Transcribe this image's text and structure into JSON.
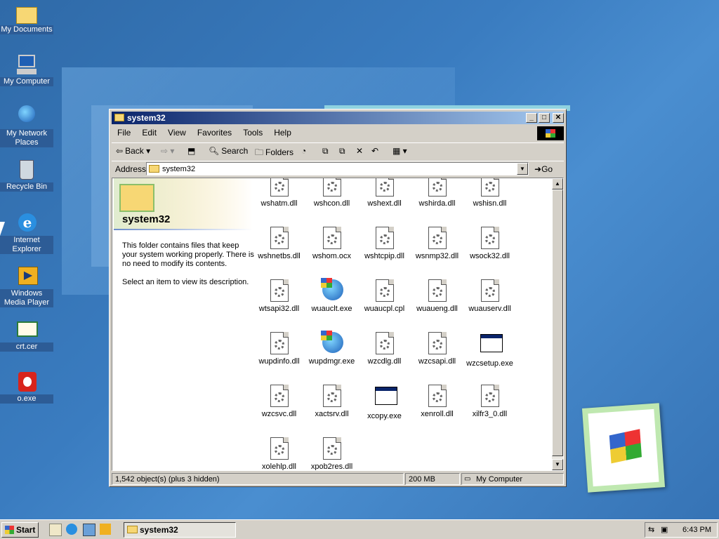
{
  "desktop": {
    "icons": [
      {
        "label": "My Documents",
        "icon": "folder-icon"
      },
      {
        "label": "My Computer",
        "icon": "computer-icon"
      },
      {
        "label": "My Network Places",
        "icon": "network-icon"
      },
      {
        "label": "Recycle Bin",
        "icon": "recycle-bin-icon"
      },
      {
        "label": "Internet Explorer",
        "icon": "internet-explorer-icon"
      },
      {
        "label": "Windows Media Player",
        "icon": "media-player-icon"
      },
      {
        "label": "crt.cer",
        "icon": "certificate-icon"
      },
      {
        "label": "o.exe",
        "icon": "app-icon"
      }
    ]
  },
  "window": {
    "title": "system32",
    "menu": [
      "File",
      "Edit",
      "View",
      "Favorites",
      "Tools",
      "Help"
    ],
    "toolbar": {
      "back": "Back",
      "search": "Search",
      "folders": "Folders"
    },
    "address": {
      "label": "Address",
      "value": "system32",
      "go": "Go"
    },
    "left_pane": {
      "title": "system32",
      "description": "This folder contains files that keep your system working properly. There is no need to modify its contents.",
      "hint": "Select an item to view its description."
    },
    "files": [
      {
        "name": "wshatm.dll",
        "type": "dll"
      },
      {
        "name": "wshcon.dll",
        "type": "dll"
      },
      {
        "name": "wshext.dll",
        "type": "dll"
      },
      {
        "name": "wshirda.dll",
        "type": "dll"
      },
      {
        "name": "wshisn.dll",
        "type": "dll"
      },
      {
        "name": "wshnetbs.dll",
        "type": "dll"
      },
      {
        "name": "wshom.ocx",
        "type": "dll"
      },
      {
        "name": "wshtcpip.dll",
        "type": "dll"
      },
      {
        "name": "wsnmp32.dll",
        "type": "dll"
      },
      {
        "name": "wsock32.dll",
        "type": "dll"
      },
      {
        "name": "wtsapi32.dll",
        "type": "dll"
      },
      {
        "name": "wuauclt.exe",
        "type": "globe"
      },
      {
        "name": "wuaucpl.cpl",
        "type": "dll"
      },
      {
        "name": "wuaueng.dll",
        "type": "dll"
      },
      {
        "name": "wuauserv.dll",
        "type": "dll"
      },
      {
        "name": "wupdinfo.dll",
        "type": "dll"
      },
      {
        "name": "wupdmgr.exe",
        "type": "globe"
      },
      {
        "name": "wzcdlg.dll",
        "type": "dll"
      },
      {
        "name": "wzcsapi.dll",
        "type": "dll"
      },
      {
        "name": "wzcsetup.exe",
        "type": "exe"
      },
      {
        "name": "wzcsvc.dll",
        "type": "dll"
      },
      {
        "name": "xactsrv.dll",
        "type": "dll"
      },
      {
        "name": "xcopy.exe",
        "type": "exe"
      },
      {
        "name": "xenroll.dll",
        "type": "dll"
      },
      {
        "name": "xilfr3_0.dll",
        "type": "dll"
      },
      {
        "name": "xolehlp.dll",
        "type": "dll"
      },
      {
        "name": "xpob2res.dll",
        "type": "dll"
      }
    ],
    "status": {
      "objects": "1,542 object(s) (plus 3 hidden)",
      "size": "200 MB",
      "zone": "My Computer"
    }
  },
  "taskbar": {
    "start": "Start",
    "task": "system32",
    "clock": "6:43 PM"
  }
}
